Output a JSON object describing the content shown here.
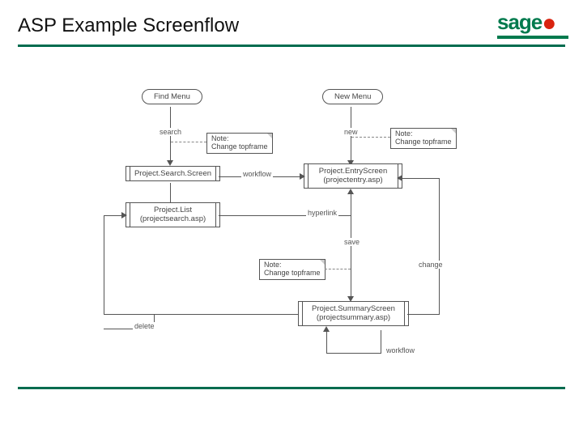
{
  "header": {
    "title": "ASP Example Screenflow",
    "logo_text": "sage"
  },
  "diagram": {
    "pills": {
      "find_menu": "Find Menu",
      "new_menu": "New Menu"
    },
    "boxes": {
      "search_screen": "Project.Search.Screen",
      "project_list_line1": "Project.List",
      "project_list_line2": "(projectsearch.asp)",
      "entry_screen_line1": "Project.EntryScreen",
      "entry_screen_line2": "(projectentry.asp)",
      "summary_line1": "Project.SummaryScreen",
      "summary_line2": "(projectsummary.asp)"
    },
    "notes": {
      "n1_line1": "Note:",
      "n1_line2": "Change topframe",
      "n2_line1": "Note:",
      "n2_line2": "Change topframe",
      "n3_line1": "Note:",
      "n3_line2": "Change topframe"
    },
    "labels": {
      "search": "search",
      "new": "new",
      "workflow1": "workflow",
      "hyperlink": "hyperlink",
      "save": "save",
      "change": "change",
      "delete": "delete",
      "workflow2": "workflow"
    }
  }
}
